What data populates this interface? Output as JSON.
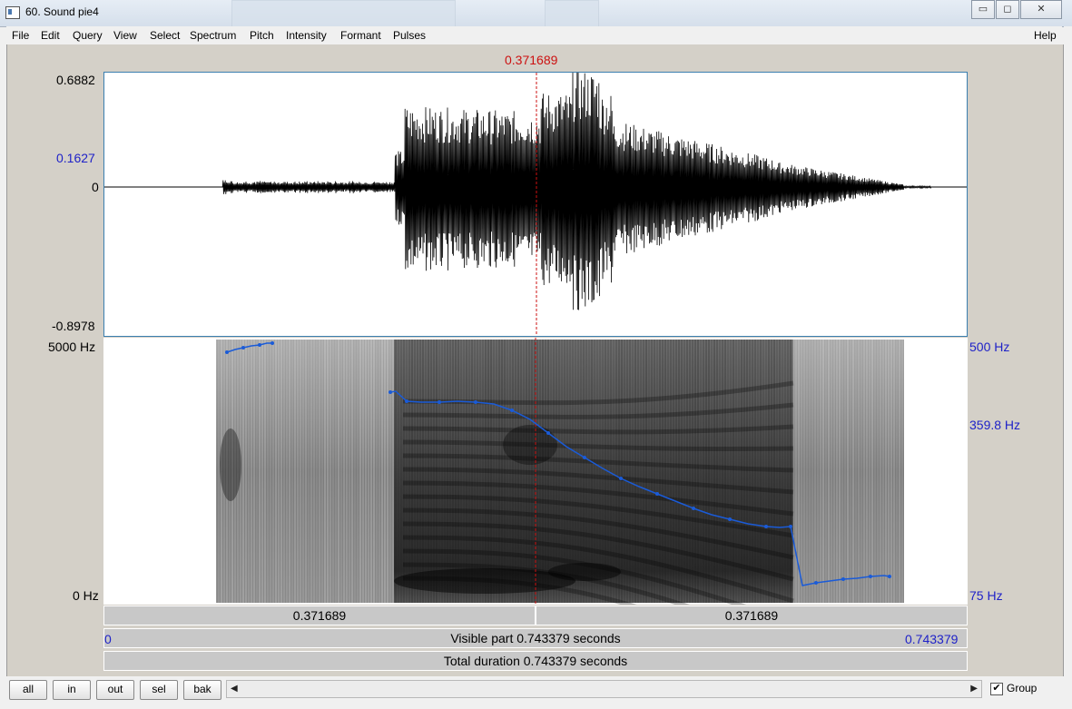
{
  "window": {
    "title": "60. Sound pie4",
    "minimize": "▭",
    "maximize": "◻",
    "close": "✕"
  },
  "menu": {
    "items": [
      "File",
      "Edit",
      "Query",
      "View",
      "Select",
      "Spectrum",
      "Pitch",
      "Intensity",
      "Formant",
      "Pulses"
    ],
    "help": "Help"
  },
  "cursor_time": "0.371689",
  "waveform": {
    "max_label": "0.6882",
    "cursor_value_label": "0.1627",
    "zero_label": "0",
    "min_label": "-0.8978"
  },
  "spectrogram": {
    "freq_top": "5000 Hz",
    "freq_bottom": "0 Hz",
    "pitch_top": "500 Hz",
    "pitch_cursor": "359.8 Hz",
    "pitch_bottom": "75 Hz"
  },
  "time_bars": {
    "left_part": "0.371689",
    "right_part": "0.371689",
    "start": "0",
    "visible": "Visible part 0.743379 seconds",
    "end": "0.743379",
    "total": "Total duration 0.743379 seconds"
  },
  "buttons": {
    "all": "all",
    "in": "in",
    "out": "out",
    "sel": "sel",
    "bak": "bak"
  },
  "scroll": {
    "left": "◀",
    "right": "▶"
  },
  "group": {
    "label": "Group",
    "checked": "✔"
  },
  "colors": {
    "cursor": "#cc1111",
    "pitch_curve": "#1a5bd8",
    "axis_blue": "#1f22c8"
  }
}
